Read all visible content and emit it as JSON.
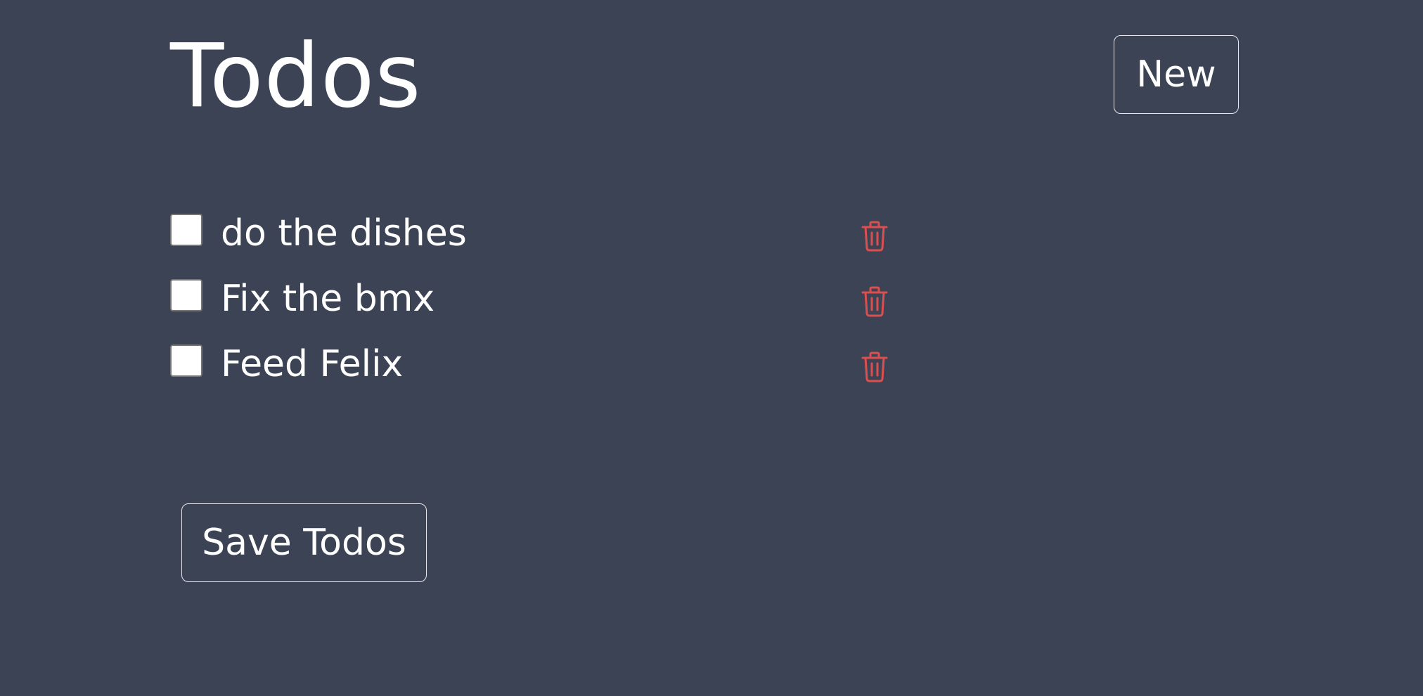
{
  "header": {
    "title": "Todos",
    "new_label": "New"
  },
  "todos": [
    {
      "text": "do the dishes",
      "checked": false
    },
    {
      "text": "Fix the bmx",
      "checked": false
    },
    {
      "text": "Feed Felix",
      "checked": false
    }
  ],
  "footer": {
    "save_label": "Save Todos"
  },
  "icons": {
    "delete": "trash-icon"
  },
  "colors": {
    "background": "#3b4355",
    "text": "#ffffff",
    "delete_icon": "#dc4f4f"
  }
}
